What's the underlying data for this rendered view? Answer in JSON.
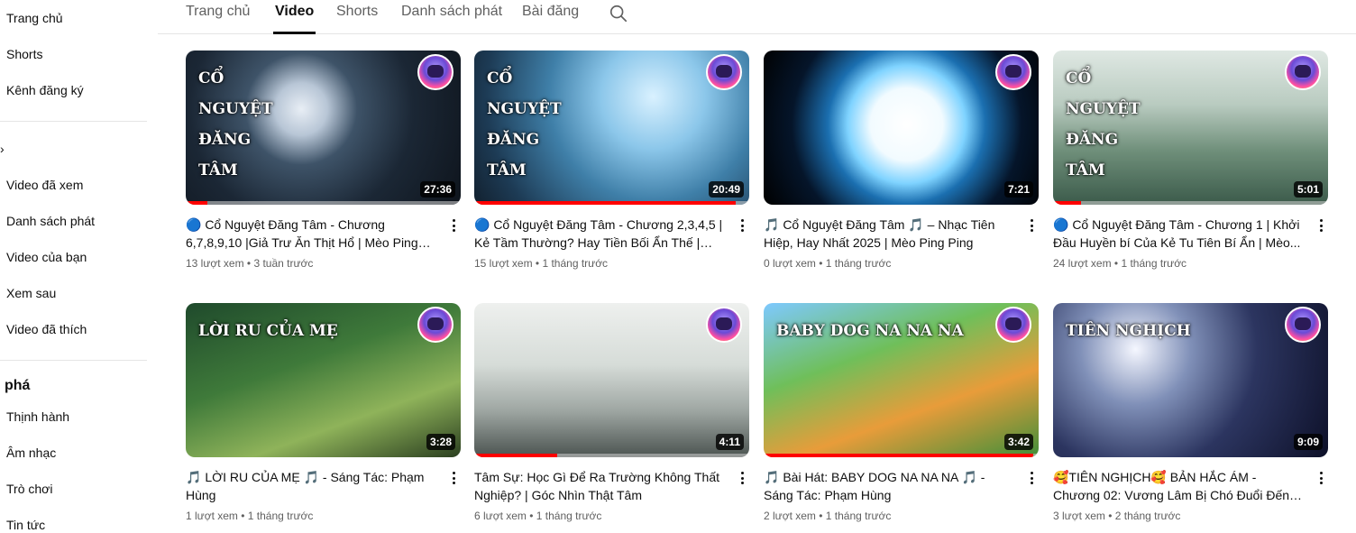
{
  "sidebar": {
    "items_top": [
      "Trang chủ",
      "Shorts",
      "Kênh đăng ký"
    ],
    "chevron": "›",
    "items_you": [
      "Video đã xem",
      "Danh sách phát",
      "Video của bạn",
      "Xem sau",
      "Video đã thích"
    ],
    "explore_heading": "phá",
    "items_explore": [
      "Thịnh hành",
      "Âm nhạc",
      "Trò chơi",
      "Tin tức"
    ]
  },
  "tabs": [
    {
      "label": "Trang chủ",
      "active": false
    },
    {
      "label": "Video",
      "active": true
    },
    {
      "label": "Shorts",
      "active": false
    },
    {
      "label": "Danh sách phát",
      "active": false
    },
    {
      "label": "Bài đăng",
      "active": false
    }
  ],
  "search_icon": "search-icon",
  "videos": [
    {
      "title": "🔵 Cổ Nguyệt Đăng Tâm - Chương 6,7,8,9,10 |Giả Trư Ăn Thịt Hổ | Mèo Ping Ping 🤔",
      "stats": "13 lượt xem • 3 tuần trước",
      "duration": "27:36",
      "progress": 0.08,
      "thumb_text": "CỔ\nNGUYỆT\nĐĂNG\nTÂM"
    },
    {
      "title": "🔵 Cổ Nguyệt Đăng Tâm - Chương 2,3,4,5 | Kẻ Tầm Thường? Hay Tiền Bối Ẩn Thế | Mè...",
      "stats": "15 lượt xem • 1 tháng trước",
      "duration": "20:49",
      "progress": 0.95,
      "thumb_text": "CỔ\nNGUYỆT\nĐĂNG\nTÂM"
    },
    {
      "title": "🎵 Cổ Nguyệt Đăng Tâm 🎵 – Nhạc Tiên Hiệp, Hay Nhất 2025 | Mèo Ping Ping",
      "stats": "0 lượt xem • 1 tháng trước",
      "duration": "7:21",
      "progress": 0,
      "thumb_text": ""
    },
    {
      "title": "🔵 Cổ Nguyệt Đăng Tâm - Chương 1 | Khởi Đầu Huyền bí Của Kẻ Tu Tiên Bí Ẩn | Mèo...",
      "stats": "24 lượt xem • 1 tháng trước",
      "duration": "5:01",
      "progress": 0.1,
      "thumb_text": "CỔ\nNGUYỆT\nĐĂNG\nTÂM"
    },
    {
      "title": "🎵 LỜI RU CỦA MẸ 🎵 - Sáng Tác: Phạm Hùng",
      "stats": "1 lượt xem • 1 tháng trước",
      "duration": "3:28",
      "progress": 0,
      "thumb_text": "LỜI RU CỦA MẸ"
    },
    {
      "title": "Tâm Sự: Học Gì Để Ra Trường Không Thất Nghiệp? | Góc Nhìn Thật Tâm",
      "stats": "6 lượt xem • 1 tháng trước",
      "duration": "4:11",
      "progress": 0.3,
      "thumb_text": ""
    },
    {
      "title": "🎵 Bài Hát: BABY DOG NA NA NA 🎵 - Sáng Tác: Phạm Hùng",
      "stats": "2 lượt xem • 1 tháng trước",
      "duration": "3:42",
      "progress": 0.98,
      "thumb_text": "BABY DOG NA NA NA"
    },
    {
      "title": "🥰TIÊN NGHỊCH🥰 BẢN HẮC ÁM - Chương 02: Vương Lâm Bị Chó Đuổi Đến Cửa Môn...",
      "stats": "3 lượt xem • 2 tháng trước",
      "duration": "9:09",
      "progress": 0,
      "thumb_text": "TIÊN NGHỊCH"
    }
  ]
}
